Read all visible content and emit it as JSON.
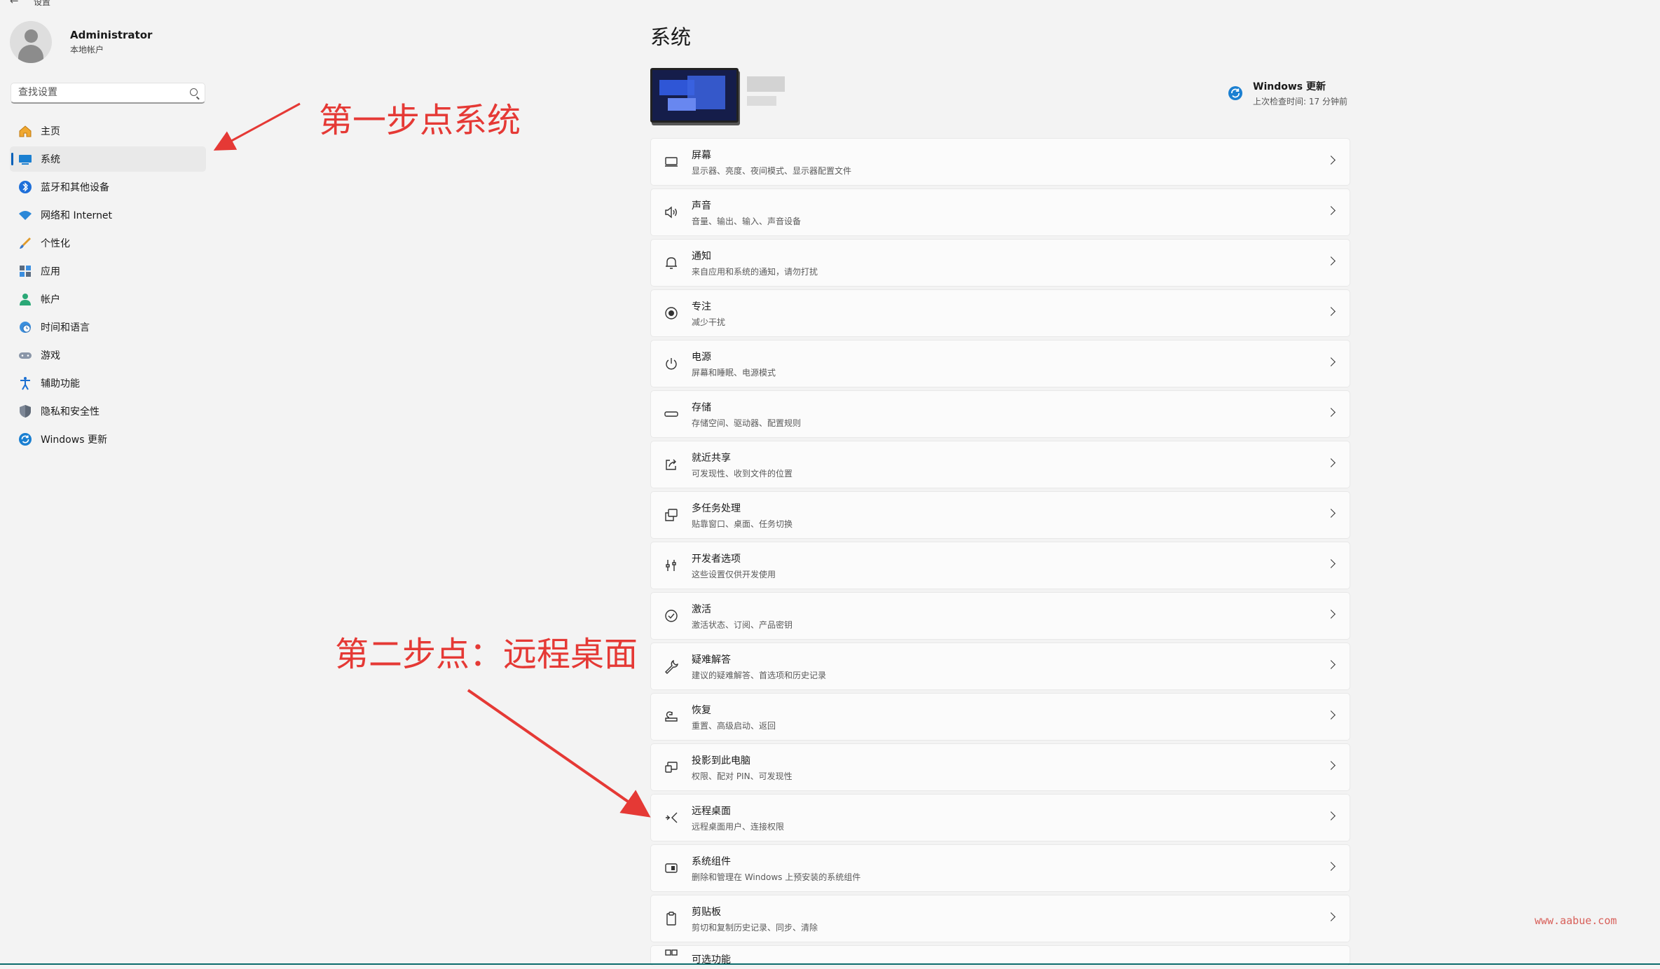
{
  "window": {
    "title": "设置"
  },
  "profile": {
    "name": "Administrator",
    "type": "本地帐户"
  },
  "search": {
    "placeholder": "查找设置"
  },
  "sidebar": {
    "items": [
      {
        "label": "主页",
        "icon": "home-icon"
      },
      {
        "label": "系统",
        "icon": "system-icon",
        "active": true
      },
      {
        "label": "蓝牙和其他设备",
        "icon": "bluetooth-icon"
      },
      {
        "label": "网络和 Internet",
        "icon": "wifi-icon"
      },
      {
        "label": "个性化",
        "icon": "brush-icon"
      },
      {
        "label": "应用",
        "icon": "apps-icon"
      },
      {
        "label": "帐户",
        "icon": "account-icon"
      },
      {
        "label": "时间和语言",
        "icon": "globe-clock-icon"
      },
      {
        "label": "游戏",
        "icon": "gamepad-icon"
      },
      {
        "label": "辅助功能",
        "icon": "accessibility-icon"
      },
      {
        "label": "隐私和安全性",
        "icon": "shield-icon"
      },
      {
        "label": "Windows 更新",
        "icon": "update-icon"
      }
    ]
  },
  "main": {
    "title": "系统",
    "windows_update": {
      "title": "Windows 更新",
      "subtitle": "上次检查时间: 17 分钟前"
    },
    "cards": [
      {
        "title": "屏幕",
        "subtitle": "显示器、亮度、夜间模式、显示器配置文件",
        "icon": "display-icon"
      },
      {
        "title": "声音",
        "subtitle": "音量、输出、输入、声音设备",
        "icon": "speaker-icon"
      },
      {
        "title": "通知",
        "subtitle": "来自应用和系统的通知，请勿打扰",
        "icon": "bell-icon"
      },
      {
        "title": "专注",
        "subtitle": "减少干扰",
        "icon": "focus-icon"
      },
      {
        "title": "电源",
        "subtitle": "屏幕和睡眠、电源模式",
        "icon": "power-icon"
      },
      {
        "title": "存储",
        "subtitle": "存储空间、驱动器、配置规则",
        "icon": "storage-icon"
      },
      {
        "title": "就近共享",
        "subtitle": "可发现性、收到文件的位置",
        "icon": "share-icon"
      },
      {
        "title": "多任务处理",
        "subtitle": "贴靠窗口、桌面、任务切换",
        "icon": "multitask-icon"
      },
      {
        "title": "开发者选项",
        "subtitle": "这些设置仅供开发使用",
        "icon": "developer-icon"
      },
      {
        "title": "激活",
        "subtitle": "激活状态、订阅、产品密钥",
        "icon": "check-circle-icon"
      },
      {
        "title": "疑难解答",
        "subtitle": "建议的疑难解答、首选项和历史记录",
        "icon": "wrench-icon"
      },
      {
        "title": "恢复",
        "subtitle": "重置、高级启动、返回",
        "icon": "recovery-icon"
      },
      {
        "title": "投影到此电脑",
        "subtitle": "权限、配对 PIN、可发现性",
        "icon": "project-icon"
      },
      {
        "title": "远程桌面",
        "subtitle": "远程桌面用户、连接权限",
        "icon": "remote-desktop-icon"
      },
      {
        "title": "系统组件",
        "subtitle": "删除和管理在 Windows 上预安装的系统组件",
        "icon": "components-icon"
      },
      {
        "title": "剪贴板",
        "subtitle": "剪切和复制历史记录、同步、清除",
        "icon": "clipboard-icon"
      },
      {
        "title": "可选功能",
        "subtitle": "",
        "icon": "optional-features-icon"
      }
    ]
  },
  "annotations": {
    "step1": "第一步点系统",
    "step2": "第二步点：远程桌面"
  },
  "watermark": "www.aabue.com",
  "colors": {
    "accent": "#005fb8",
    "annotation": "#e53935",
    "background": "#f3f3f3",
    "card": "#fbfbfb"
  }
}
